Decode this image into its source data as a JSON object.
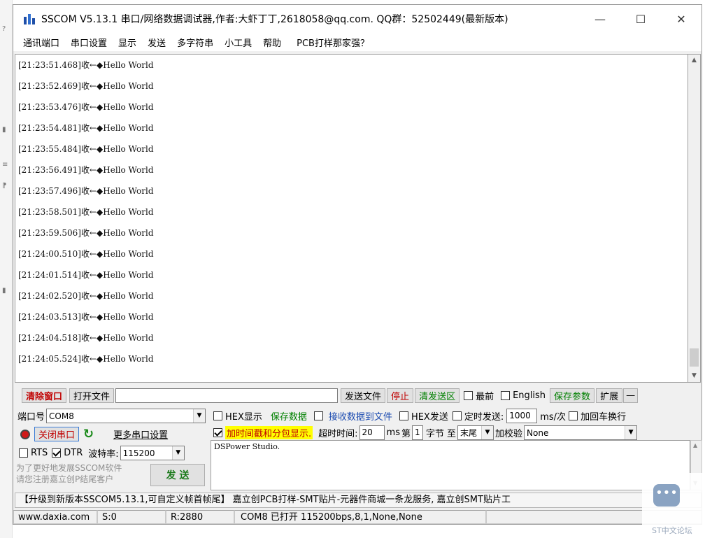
{
  "window": {
    "title": "SSCOM V5.13.1 串口/网络数据调试器,作者:大虾丁丁,2618058@qq.com. QQ群：52502449(最新版本)",
    "minimize_glyph": "—",
    "maximize_glyph": "☐",
    "close_glyph": "✕"
  },
  "menu": [
    "通讯端口",
    "串口设置",
    "显示",
    "发送",
    "多字符串",
    "小工具",
    "帮助",
    "PCB打样那家强？"
  ],
  "receive_log": [
    "[21:23:51.468]收←◆Hello World",
    "[21:23:52.469]收←◆Hello World",
    "[21:23:53.476]收←◆Hello World",
    "[21:23:54.481]收←◆Hello World",
    "[21:23:55.484]收←◆Hello World",
    "[21:23:56.491]收←◆Hello World",
    "[21:23:57.496]收←◆Hello World",
    "[21:23:58.501]收←◆Hello World",
    "[21:23:59.506]收←◆Hello World",
    "[21:24:00.510]收←◆Hello World",
    "[21:24:01.514]收←◆Hello World",
    "[21:24:02.520]收←◆Hello World",
    "[21:24:03.513]收←◆Hello World",
    "[21:24:04.518]收←◆Hello World",
    "[21:24:05.524]收←◆Hello World"
  ],
  "toolbar": {
    "clear_window": "清除窗口",
    "open_file": "打开文件",
    "file_path": "",
    "send_file": "发送文件",
    "stop": "停止",
    "clear_send": "清发送区",
    "topmost": "最前",
    "english": "English",
    "save_params": "保存参数",
    "expand": "扩展",
    "collapse": "—"
  },
  "port": {
    "port_label": "端口号",
    "port_value": "COM8",
    "close_port": "关闭串口",
    "more_settings": "更多串口设置",
    "rts": "RTS",
    "dtr": "DTR",
    "baud_label": "波特率:",
    "baud_value": "115200",
    "promo_line1": "为了更好地发展SSCOM软件",
    "promo_line2": "请您注册嘉立创P结尾客户",
    "send_button": "发 送"
  },
  "options": {
    "hex_display": "HEX显示",
    "save_data": "保存数据",
    "recv_to_file": "接收数据到文件",
    "hex_send": "HEX发送",
    "timed_send": "定时发送:",
    "timed_value": "1000",
    "timed_unit": "ms/次",
    "add_crlf": "加回车换行",
    "timestamp": "加时间戳和分包显示.",
    "timeout_label": "超时时间:",
    "timeout_value": "20",
    "timeout_unit": "ms",
    "byte_label_pre": "第",
    "byte_value": "1",
    "byte_label_post": "字节",
    "to_label": "至",
    "end_value": "末尾",
    "checksum_label": "加校验",
    "checksum_value": "None"
  },
  "send_text": "DSPower Studio.",
  "ad_bar": "【升级到新版本SSCOM5.13.1,可自定义帧首帧尾】  嘉立创PCB打样-SMT贴片-元器件商城一条龙服务, 嘉立创SMT贴片工",
  "status": {
    "website": "www.daxia.com",
    "sent": "S:0",
    "received": "R:2880",
    "port_state": "COM8 已打开  115200bps,8,1,None,None"
  },
  "watermark_text": "ST中文论坛"
}
